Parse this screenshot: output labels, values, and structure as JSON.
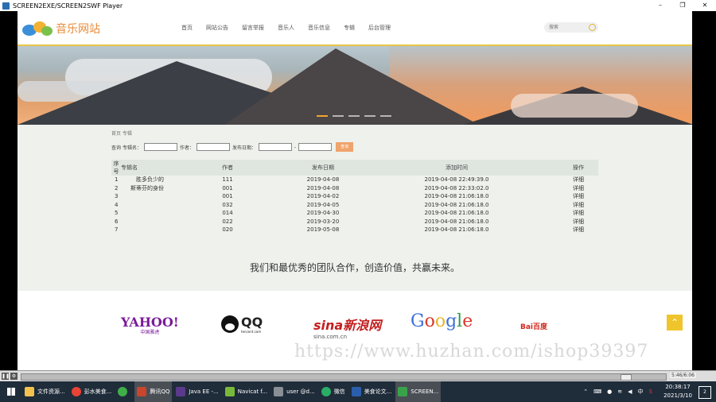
{
  "window": {
    "title": "SCREEN2EXE/SCREEN2SWF Player",
    "min": "–",
    "max": "❐",
    "close": "✕"
  },
  "site": {
    "logo_text": "音乐网站",
    "nav": [
      "首页",
      "网站公告",
      "留言举报",
      "音乐人",
      "音乐信息",
      "专辑",
      "后台管理"
    ],
    "search_placeholder": "搜索"
  },
  "breadcrumb": "首页 专辑",
  "filter": {
    "label_search": "查询",
    "label_album": "专辑名：",
    "label_author": "作者：",
    "label_date": "发布日期：",
    "button": "查询"
  },
  "table": {
    "headers": [
      "序号",
      "专辑名",
      "作者",
      "发布日期",
      "添加时间",
      "操作"
    ],
    "rows": [
      [
        "1",
        "胜多负少的",
        "111",
        "2019-04-08",
        "2019-04-08 22:49:39.0",
        "详细"
      ],
      [
        "2",
        "斯蒂芬的身份",
        "001",
        "2019-04-08",
        "2019-04-08 22:33:02.0",
        "详细"
      ],
      [
        "3",
        "",
        "001",
        "2019-04-02",
        "2019-04-08 21:06:18.0",
        "详细"
      ],
      [
        "4",
        "",
        "032",
        "2019-04-05",
        "2019-04-08 21:06:18.0",
        "详细"
      ],
      [
        "5",
        "",
        "014",
        "2019-04-30",
        "2019-04-08 21:06:18.0",
        "详细"
      ],
      [
        "6",
        "",
        "022",
        "2019-03-20",
        "2019-04-08 21:06:18.0",
        "详细"
      ],
      [
        "7",
        "",
        "020",
        "2019-05-08",
        "2019-04-08 21:06:18.0",
        "详细"
      ]
    ]
  },
  "slogan": "我们和最优秀的团队合作，创造价值，共赢未来。",
  "partners": {
    "yahoo": "YAHOO!",
    "yahoo_sub": "中国雅虎",
    "qq": "QQ",
    "qq_sub": "tencent.com",
    "sina": "sina新浪网",
    "sina_sub": "sina.com.cn",
    "google": "Google",
    "baidu": "Bai百度"
  },
  "watermark": "https://www.huzhan.com/ishop39397",
  "player": {
    "time": "5:46/6:06"
  },
  "taskbar": {
    "items": [
      {
        "label": "文件资源...",
        "color": "#f2c14e"
      },
      {
        "label": "彭水美食...",
        "color": "#e94335"
      },
      {
        "label": "",
        "color": "#3fae49"
      },
      {
        "label": "腾讯QQ",
        "color": "#c9462c",
        "active": true
      },
      {
        "label": "Java EE -...",
        "color": "#5b3a8c"
      },
      {
        "label": "Navicat f...",
        "color": "#79b93a"
      },
      {
        "label": "user @d...",
        "color": "#8a8f96"
      },
      {
        "label": "微信",
        "color": "#2aae67"
      },
      {
        "label": "美食论文...",
        "color": "#2b5fad"
      },
      {
        "label": "SCREEN...",
        "color": "#3aa34a"
      }
    ],
    "ime": "中",
    "time": "20:38:17",
    "date": "2021/3/10",
    "notif": "2"
  }
}
